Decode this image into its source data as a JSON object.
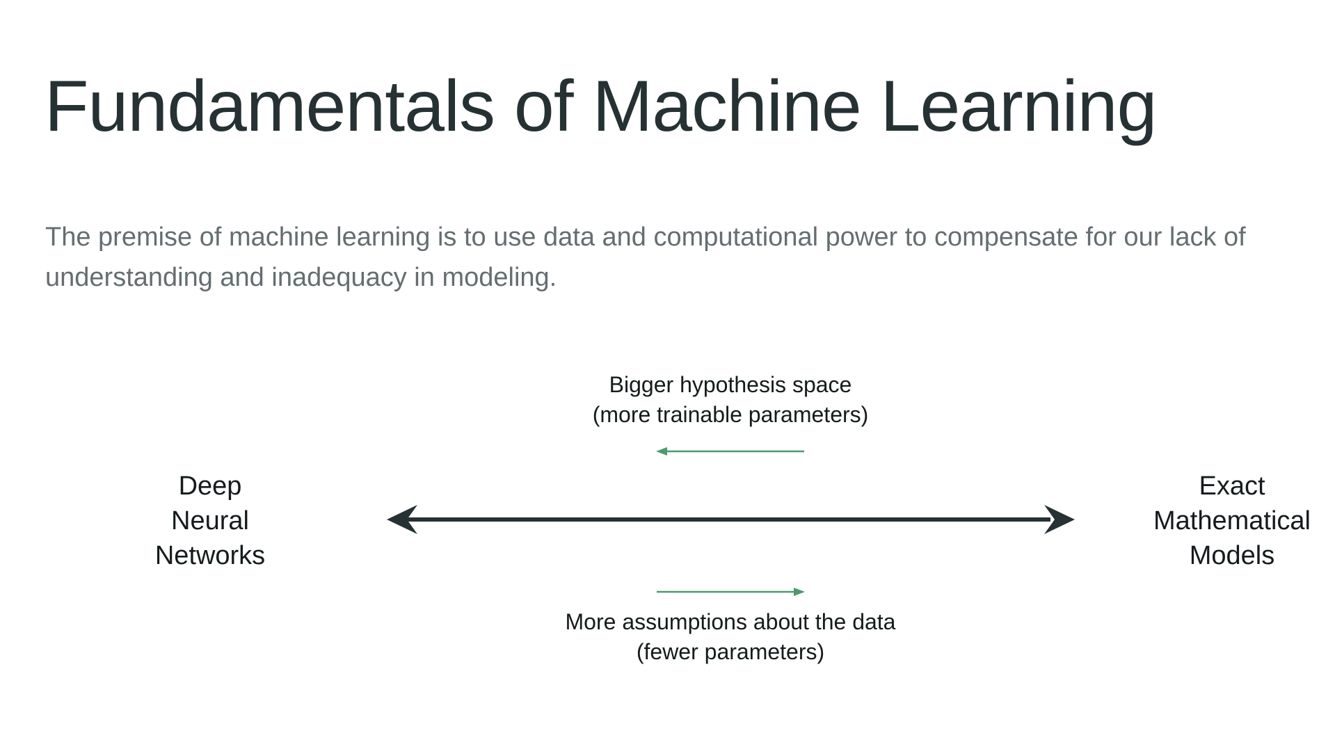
{
  "slide": {
    "title": "Fundamentals of Machine Learning",
    "intro_lines": [
      "The premise of machine learning is to use data and computational power to compensate for our lack of",
      "understanding and inadequacy in modeling."
    ]
  },
  "diagram": {
    "left_end": {
      "lines": [
        "Deep",
        "Neural",
        "Networks"
      ]
    },
    "right_end": {
      "lines": [
        "Exact",
        "Mathematical",
        "Models"
      ]
    },
    "top_note": {
      "lines": [
        "Bigger hypothesis space",
        "(more trainable parameters)"
      ],
      "arrow_direction": "left"
    },
    "bottom_note": {
      "lines": [
        "More assumptions about the data",
        "(fewer parameters)"
      ],
      "arrow_direction": "right"
    },
    "colors": {
      "main_arrow": "#263133",
      "direction_arrows": "#4a9a6e",
      "text": "#151b1c",
      "title": "#263133",
      "intro": "#646e70"
    }
  }
}
